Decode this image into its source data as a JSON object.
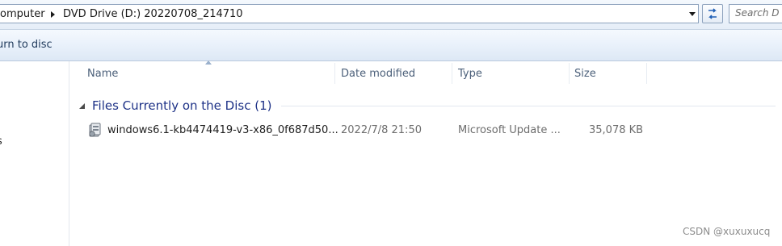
{
  "address": {
    "crumbs": [
      "omputer",
      "DVD Drive (D:) 20220708_214710"
    ]
  },
  "search": {
    "placeholder": "Search D"
  },
  "toolbar": {
    "burn_label": "urn to disc"
  },
  "nav": {
    "partial_item": "s"
  },
  "columns": {
    "name": "Name",
    "date_modified": "Date modified",
    "type": "Type",
    "size": "Size"
  },
  "group": {
    "title": "Files Currently on the Disc (1)"
  },
  "files": [
    {
      "name": "windows6.1-kb4474419-v3-x86_0f687d50...",
      "date": "2022/7/8 21:50",
      "type": "Microsoft Update ...",
      "size": "35,078 KB",
      "icon": "update-package-icon"
    }
  ],
  "watermark": "CSDN @xuxuxucq",
  "colors": {
    "group_title": "#1e3287",
    "column_header": "#4c607a"
  }
}
